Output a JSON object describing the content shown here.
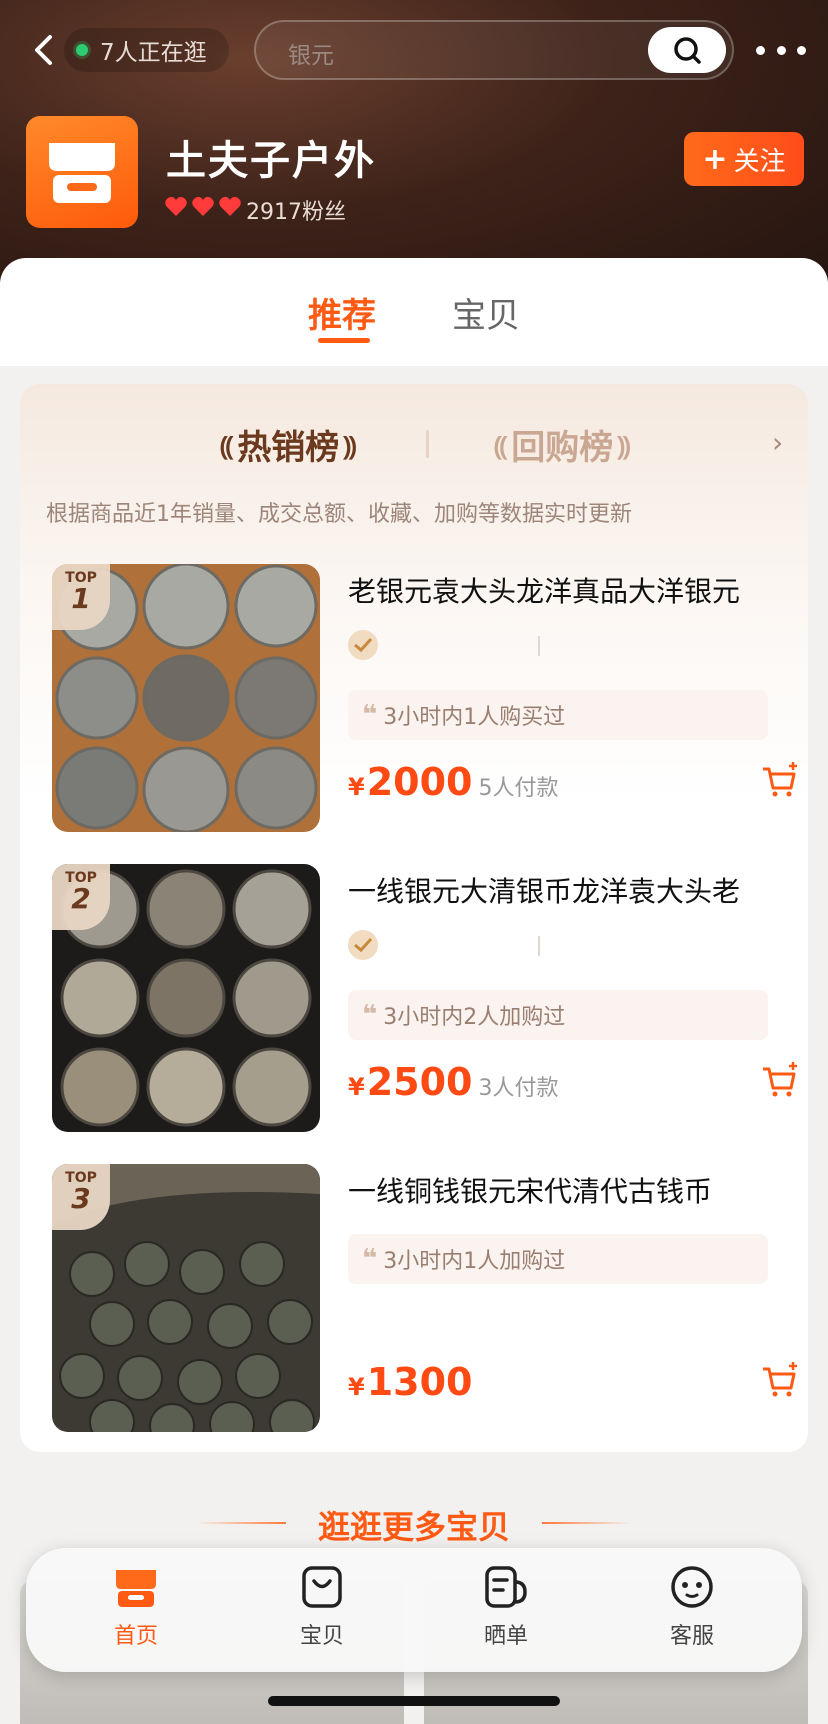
{
  "header": {
    "visitors_text": "7人正在逛",
    "search_placeholder": "银元",
    "shop_name": "土夫子户外",
    "fans_text": "2917粉丝",
    "follow_label": "关注",
    "hearts": 3
  },
  "tabs": [
    {
      "label": "推荐",
      "active": true
    },
    {
      "label": "宝贝",
      "active": false
    }
  ],
  "ranking": {
    "tabs": [
      {
        "label": "热销榜",
        "active": true
      },
      {
        "label": "回购榜",
        "active": false
      }
    ],
    "description": "根据商品近1年销量、成交总额、收藏、加购等数据实时更新",
    "items": [
      {
        "rank_label": "TOP",
        "rank": "1",
        "title": "老银元袁大头龙洋真品大洋银元",
        "verified": true,
        "recent": "3小时内1人购买过",
        "currency": "¥",
        "price": "2000",
        "paid": "5人付款"
      },
      {
        "rank_label": "TOP",
        "rank": "2",
        "title": "一线银元大清银币龙洋袁大头老",
        "verified": true,
        "recent": "3小时内2人加购过",
        "currency": "¥",
        "price": "2500",
        "paid": "3人付款"
      },
      {
        "rank_label": "TOP",
        "rank": "3",
        "title": "一线铜钱银元宋代清代古钱币",
        "verified": false,
        "recent": "3小时内1人加购过",
        "currency": "¥",
        "price": "1300",
        "paid": ""
      }
    ]
  },
  "more_section": {
    "title": "逛逛更多宝贝"
  },
  "bottom_nav": [
    {
      "label": "首页",
      "icon": "shop-home-icon",
      "active": true
    },
    {
      "label": "宝贝",
      "icon": "bag-icon",
      "active": false
    },
    {
      "label": "晒单",
      "icon": "review-icon",
      "active": false
    },
    {
      "label": "客服",
      "icon": "customer-service-icon",
      "active": false
    }
  ],
  "colors": {
    "accent": "#ff5a14",
    "header_dark": "#3d2219",
    "rank_brown": "#6b3a1e"
  }
}
